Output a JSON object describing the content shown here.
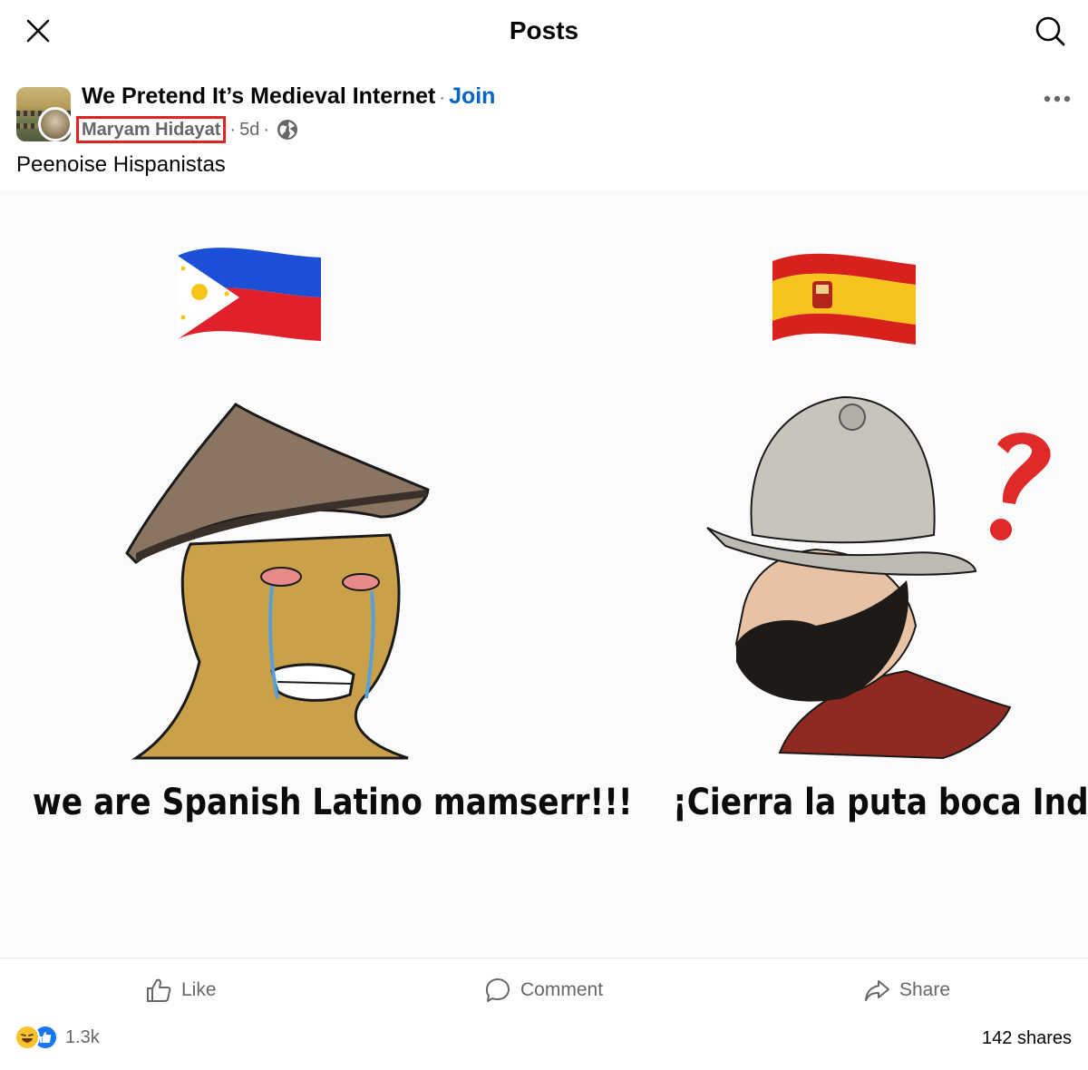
{
  "topbar": {
    "title": "Posts",
    "close_icon": "close-icon",
    "search_icon": "search-icon"
  },
  "post": {
    "group_name": "We Pretend It’s Medieval Internet",
    "separator": "·",
    "join_label": "Join",
    "author": "Maryam Hidayat",
    "time": "5d",
    "privacy_icon": "globe-icon",
    "more_icon": "more-horizontal-icon",
    "caption": "Peenoise Hispanistas"
  },
  "meme": {
    "left_text": "we are Spanish Latino mamserr!!!",
    "right_text": "¡Cierra la puta boca Indio!",
    "left_flag": "philippines-flag",
    "right_flag": "spain-flag"
  },
  "actions": {
    "like_label": "Like",
    "comment_label": "Comment",
    "share_label": "Share"
  },
  "stats": {
    "reaction_count": "1.3k",
    "shares": "142 shares"
  },
  "colors": {
    "join": "#0866c4",
    "highlight_box": "#e02424",
    "secondary_text": "#65676b"
  }
}
